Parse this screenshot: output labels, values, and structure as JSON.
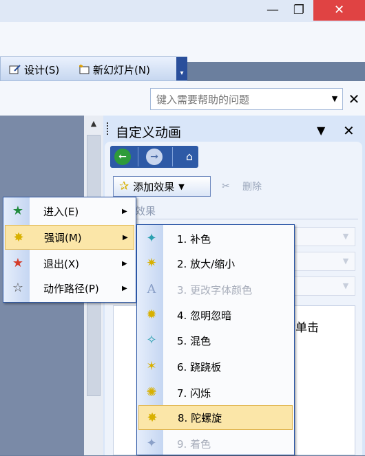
{
  "window": {
    "minimize_glyph": "—",
    "restore_glyph": "❐",
    "close_glyph": "✕"
  },
  "toolbar": {
    "design_label": "设计(S)",
    "new_slide_label": "新幻灯片(N)",
    "overflow_glyph": "▾"
  },
  "help": {
    "placeholder": "键入需要帮助的问题",
    "dropdown_glyph": "▼",
    "close_glyph": "✕"
  },
  "task_pane": {
    "title": "自定义动画",
    "menu_glyph": "▼",
    "close_glyph": "✕",
    "add_effect_label": "添加效果",
    "add_effect_arrow": "▼",
    "delete_label": "删除",
    "section_label": "效果",
    "hint_text": "后单击"
  },
  "menu_main": {
    "items": [
      {
        "label": "进入(E)",
        "icon": "entrance-star-icon",
        "color": "#1f8a3c"
      },
      {
        "label": "强调(M)",
        "icon": "emphasis-star-icon",
        "color": "#d8b000"
      },
      {
        "label": "退出(X)",
        "icon": "exit-star-icon",
        "color": "#d43c2a"
      },
      {
        "label": "动作路径(P)",
        "icon": "motion-path-star-icon",
        "color": "#ffffff"
      }
    ],
    "highlighted_index": 1
  },
  "menu_emphasis": {
    "items": [
      {
        "label": "1. 补色",
        "enabled": true
      },
      {
        "label": "2. 放大/缩小",
        "enabled": true
      },
      {
        "label": "3. 更改字体颜色",
        "enabled": false
      },
      {
        "label": "4. 忽明忽暗",
        "enabled": true
      },
      {
        "label": "5. 混色",
        "enabled": true
      },
      {
        "label": "6. 跷跷板",
        "enabled": true
      },
      {
        "label": "7. 闪烁",
        "enabled": true
      },
      {
        "label": "8. 陀螺旋",
        "enabled": true
      },
      {
        "label": "9. 着色",
        "enabled": false
      }
    ],
    "highlighted_index": 7
  }
}
